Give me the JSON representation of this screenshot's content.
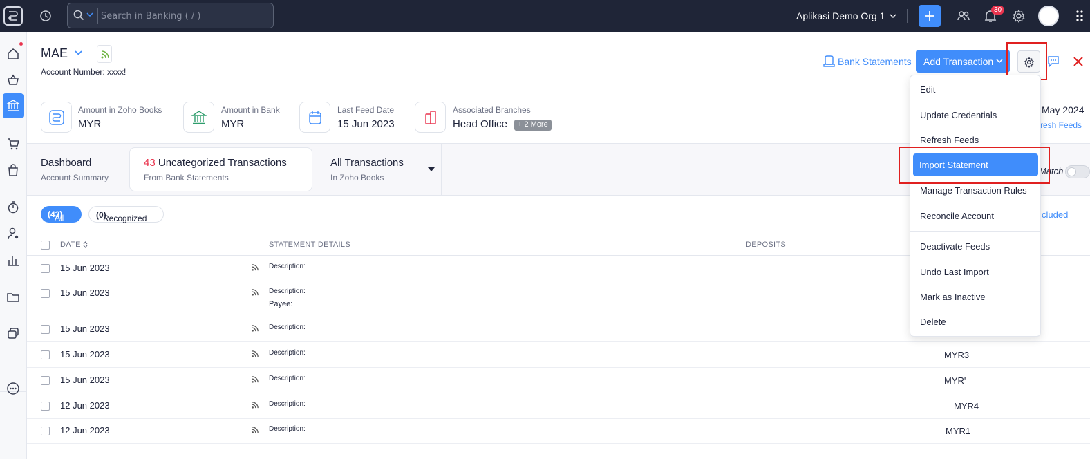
{
  "topbar": {
    "search_placeholder": "Search in Banking ( / )",
    "org_name": "Aplikasi Demo Org 1",
    "notification_count": "30"
  },
  "account": {
    "name": "MAE",
    "number_label": "Account Number: xxxx!"
  },
  "header_actions": {
    "bank_statements": "Bank Statements",
    "add_transaction": "Add Transaction"
  },
  "summary": [
    {
      "label": "Amount in Zoho Books",
      "value": "MYR"
    },
    {
      "label": "Amount in Bank",
      "value": "MYR"
    },
    {
      "label": "Last Feed Date",
      "value": "15 Jun 2023"
    },
    {
      "label": "Associated Branches",
      "value": "Head Office",
      "more": "+ 2 More"
    }
  ],
  "summary_right": {
    "date_partial": "May 2024",
    "link_partial": "resh Feeds"
  },
  "tabs": [
    {
      "title": "Dashboard",
      "sub": "Account Summary"
    },
    {
      "count": "43",
      "title": "Uncategorized Transactions",
      "sub": "From Bank Statements"
    },
    {
      "title": "All Transactions",
      "sub": "In Zoho Books"
    }
  ],
  "match_partial": "Match",
  "filters": {
    "all_label": "All",
    "all_count": "(43)",
    "recognized_label": "Recognized",
    "recognized_count": "(0)",
    "right_partial": "cluded"
  },
  "table": {
    "headers": {
      "date": "DATE",
      "details": "STATEMENT DETAILS",
      "deposits": "DEPOSITS"
    },
    "rows": [
      {
        "date": "15 Jun 2023",
        "desc": "Description:",
        "payee": "",
        "amount": ""
      },
      {
        "date": "15 Jun 2023",
        "desc": "Description:",
        "payee": "Payee:",
        "amount": ""
      },
      {
        "date": "15 Jun 2023",
        "desc": "Description:",
        "payee": "",
        "amount": ""
      },
      {
        "date": "15 Jun 2023",
        "desc": "Description:",
        "payee": "",
        "amount": "MYR3"
      },
      {
        "date": "15 Jun 2023",
        "desc": "Description:",
        "payee": "",
        "amount": "MYR'"
      },
      {
        "date": "12 Jun 2023",
        "desc": "Description:",
        "payee": "",
        "amount": "MYR4"
      },
      {
        "date": "12 Jun 2023",
        "desc": "Description:",
        "payee": "",
        "amount": "MYR1"
      }
    ]
  },
  "settings_menu": {
    "items": [
      "Edit",
      "Update Credentials",
      "Refresh Feeds",
      "Import Statement",
      "Manage Transaction Rules",
      "Reconcile Account",
      "Deactivate Feeds",
      "Undo Last Import",
      "Mark as Inactive",
      "Delete"
    ],
    "active": "Import Statement"
  },
  "colors": {
    "topbar": "#1f2537",
    "accent": "#408dfb",
    "highlight": "#e02020",
    "count_red": "#e9344e"
  }
}
